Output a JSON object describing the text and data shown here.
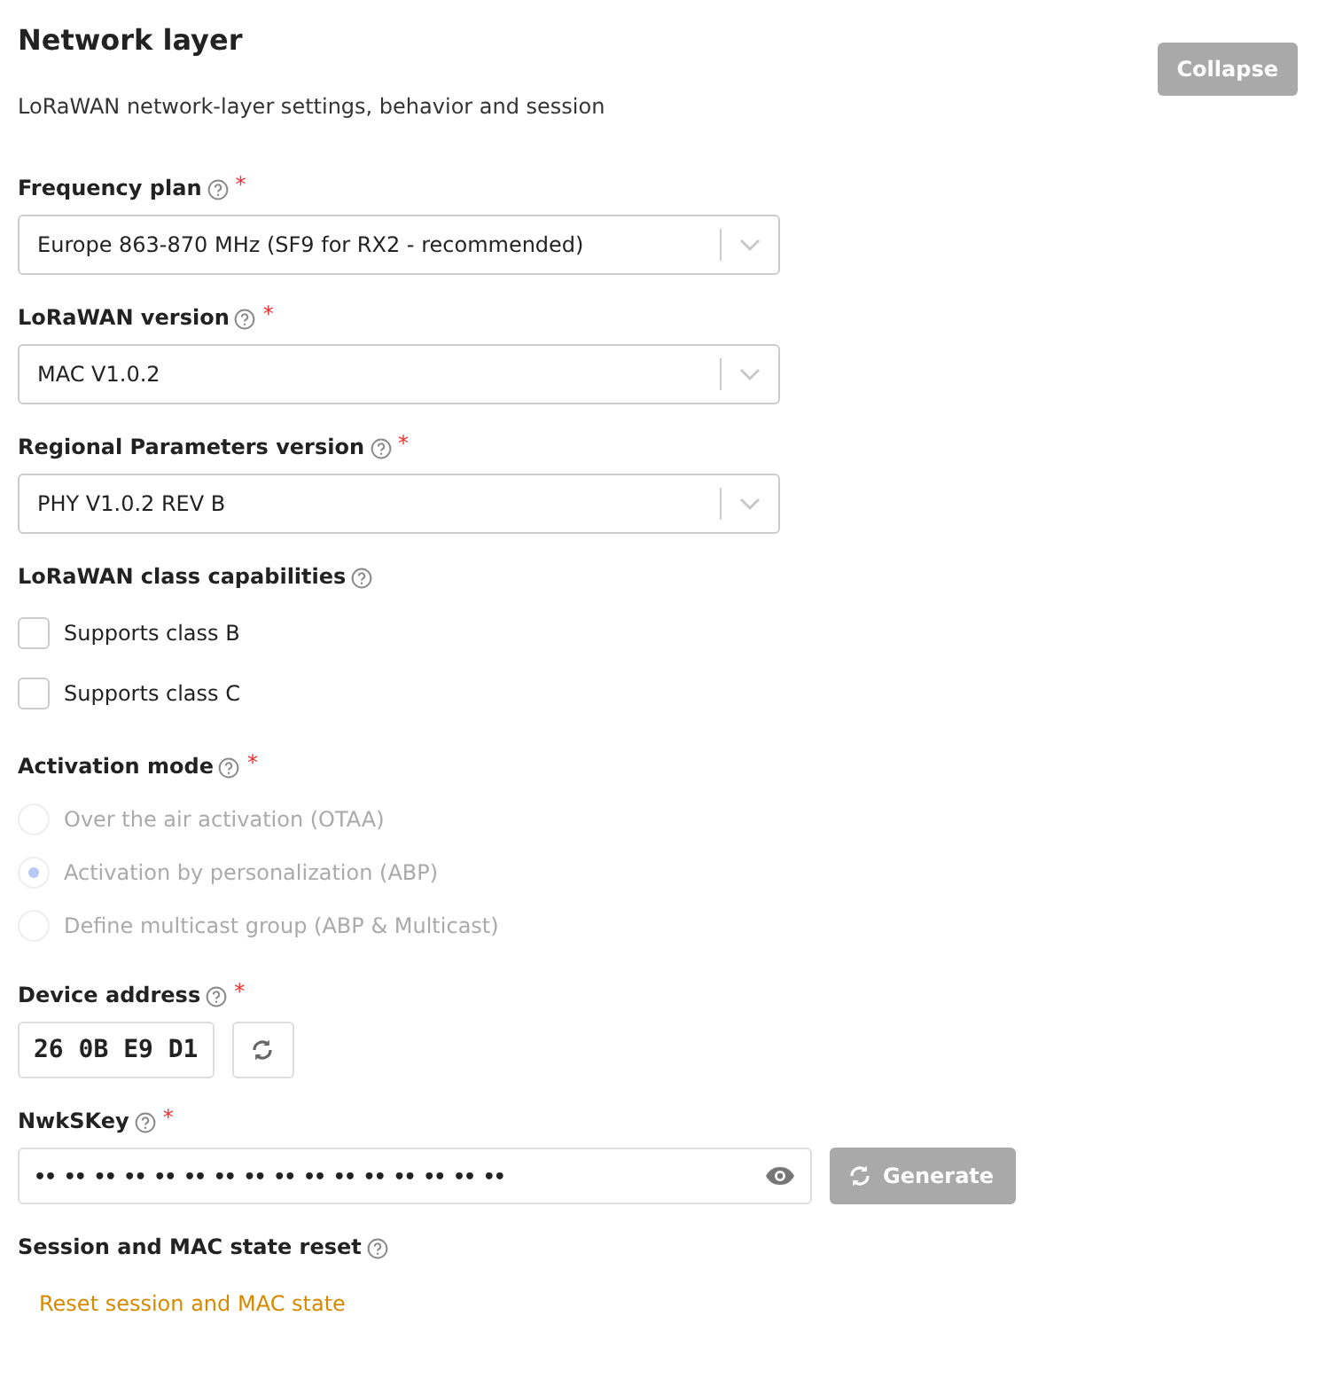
{
  "section": {
    "title": "Network layer",
    "description": "LoRaWAN network-layer settings, behavior and session",
    "collapse_button": "Collapse"
  },
  "fields": [
    {
      "kind": "select",
      "label": "Frequency plan",
      "required_mark": "*",
      "value": "Europe 863-870 MHz (SF9 for RX2 - recommended)"
    },
    {
      "kind": "select",
      "label": "LoRaWAN version",
      "required_mark": "*",
      "value": "MAC V1.0.2"
    },
    {
      "kind": "select",
      "label": "Regional Parameters version",
      "required_mark": "*",
      "value": "PHY V1.0.2 REV B"
    },
    {
      "kind": "checkboxes",
      "label": "LoRaWAN class capabilities",
      "options": [
        {
          "label": "Supports class B",
          "checked": false
        },
        {
          "label": "Supports class C",
          "checked": false
        }
      ]
    },
    {
      "kind": "radios",
      "label": "Activation mode",
      "required_mark": "*",
      "disabled": true,
      "options": [
        {
          "label": "Over the air activation (OTAA)",
          "selected": false
        },
        {
          "label": "Activation by personalization (ABP)",
          "selected": true
        },
        {
          "label": "Define multicast group (ABP & Multicast)",
          "selected": false
        }
      ]
    },
    {
      "kind": "address",
      "label": "Device address",
      "required_mark": "*",
      "value": "26 0B E9 D1"
    },
    {
      "kind": "secret",
      "label": "NwkSKey",
      "required_mark": "*",
      "value": "•• •• •• •• •• •• •• •• •• •• •• •• •• •• •• ••",
      "button": "Generate"
    },
    {
      "kind": "link",
      "label": "Session and MAC state reset",
      "link": "Reset session and MAC state"
    }
  ]
}
